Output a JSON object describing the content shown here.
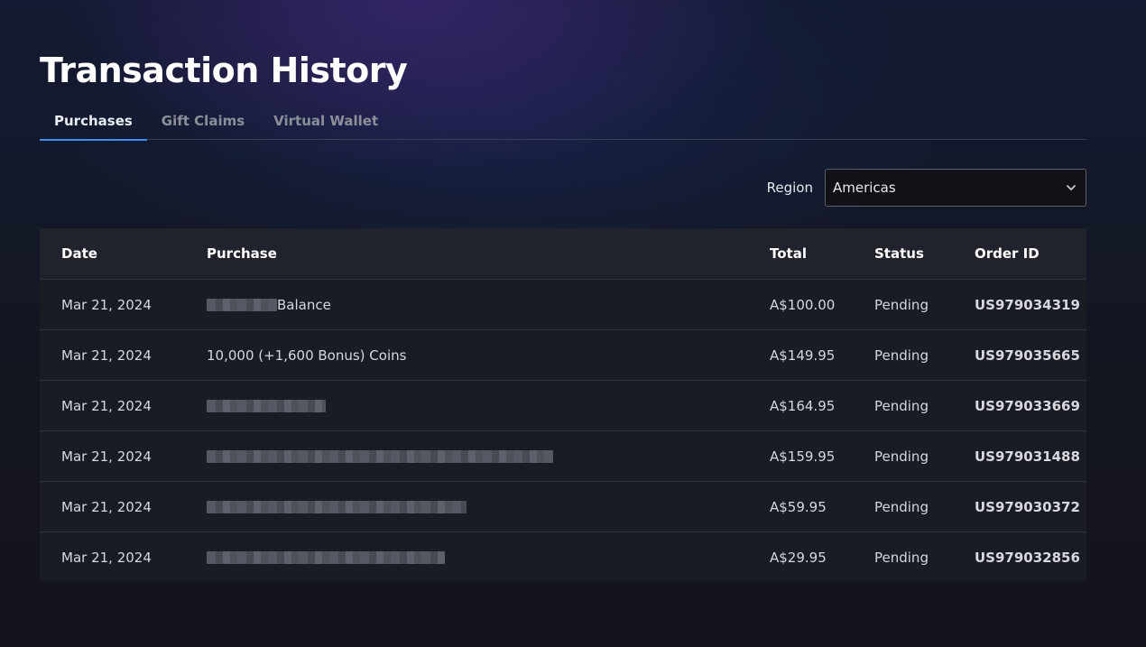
{
  "page": {
    "title": "Transaction History"
  },
  "tabs": [
    {
      "label": "Purchases",
      "active": true
    },
    {
      "label": "Gift Claims",
      "active": false
    },
    {
      "label": "Virtual Wallet",
      "active": false
    }
  ],
  "region": {
    "label": "Region",
    "selected": "Americas"
  },
  "table": {
    "headers": {
      "date": "Date",
      "purchase": "Purchase",
      "total": "Total",
      "status": "Status",
      "order_id": "Order ID"
    },
    "rows": [
      {
        "date": "Mar 21, 2024",
        "purchase": "Balance",
        "total": "A$100.00",
        "status": "Pending",
        "order_id": "US979034319"
      },
      {
        "date": "Mar 21, 2024",
        "purchase": "10,000 (+1,600 Bonus) Coins",
        "total": "A$149.95",
        "status": "Pending",
        "order_id": "US979035665"
      },
      {
        "date": "Mar 21, 2024",
        "purchase": "",
        "total": "A$164.95",
        "status": "Pending",
        "order_id": "US979033669"
      },
      {
        "date": "Mar 21, 2024",
        "purchase": "",
        "total": "A$159.95",
        "status": "Pending",
        "order_id": "US979031488"
      },
      {
        "date": "Mar 21, 2024",
        "purchase": "",
        "total": "A$59.95",
        "status": "Pending",
        "order_id": "US979030372"
      },
      {
        "date": "Mar 21, 2024",
        "purchase": "",
        "total": "A$29.95",
        "status": "Pending",
        "order_id": "US979032856"
      }
    ]
  },
  "colors": {
    "accent": "#3b8ff0",
    "link": "#2b8bf2"
  },
  "icons": {
    "region_dropdown": "chevron-down-icon"
  }
}
